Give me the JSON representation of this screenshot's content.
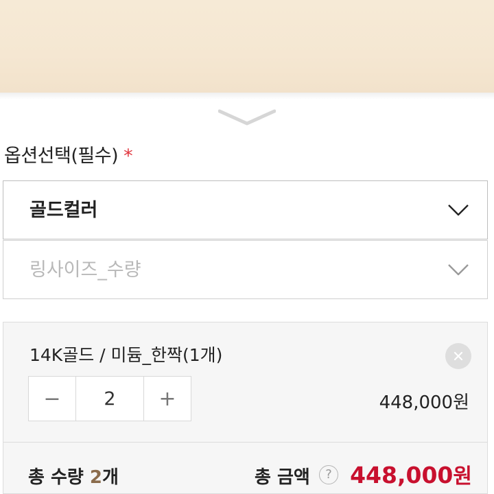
{
  "product": {
    "option_title": "옵션선택(필수)",
    "required_mark": "*"
  },
  "options": {
    "color_select_value": "골드컬러",
    "size_select_placeholder": "링사이즈_수량"
  },
  "selected_item": {
    "name": "14K골드 / 미듐_한짝(1개)",
    "remove_label": "×",
    "minus_label": "−",
    "quantity": "2",
    "plus_label": "+",
    "price": "448,000원"
  },
  "summary": {
    "total_qty_label": "총 수량",
    "total_qty_value": "2",
    "total_qty_unit": "개",
    "total_amount_label": "총 금액",
    "help_label": "?",
    "total_amount_value": "448,000",
    "total_amount_unit": "원"
  },
  "colors": {
    "accent_price": "#c8102e",
    "required": "#e0373f",
    "qty_highlight": "#8b6c4c"
  },
  "icons": [
    "chevron-down-icon",
    "close-icon",
    "minus-icon",
    "plus-icon",
    "help-icon"
  ]
}
